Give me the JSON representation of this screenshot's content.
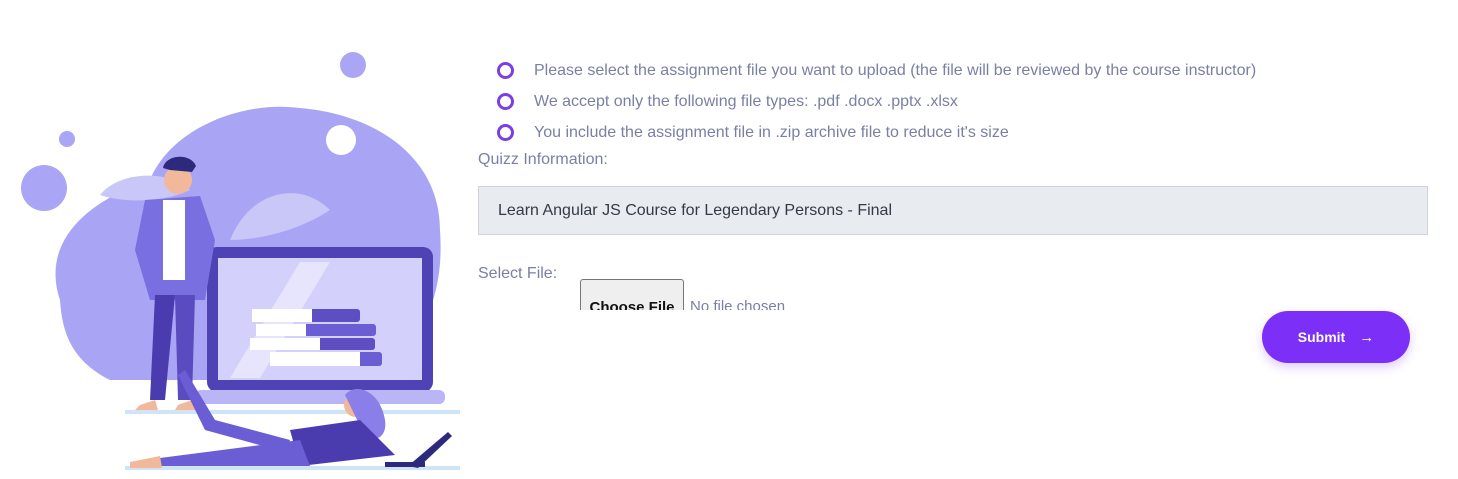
{
  "guidelines": [
    "Please select the assignment file you want to upload (the file will be reviewed by the course instructor)",
    "We accept only the following file types: .pdf .docx .pptx .xlsx",
    "You include the assignment file in .zip archive file to reduce it's size"
  ],
  "quiz": {
    "label": "Quizz Information:",
    "value": "Learn Angular JS Course for Legendary Persons - Final"
  },
  "file": {
    "label": "Select File:",
    "button_label": "Choose File",
    "status": "No file chosen"
  },
  "submit": {
    "label": "Submit",
    "icon": "arrow-right-icon"
  },
  "colors": {
    "accent": "#7b2ff7",
    "bullet": "#7b3fe4",
    "illustration_primary": "#a9a4f4",
    "illustration_dark": "#5d4ec4"
  }
}
